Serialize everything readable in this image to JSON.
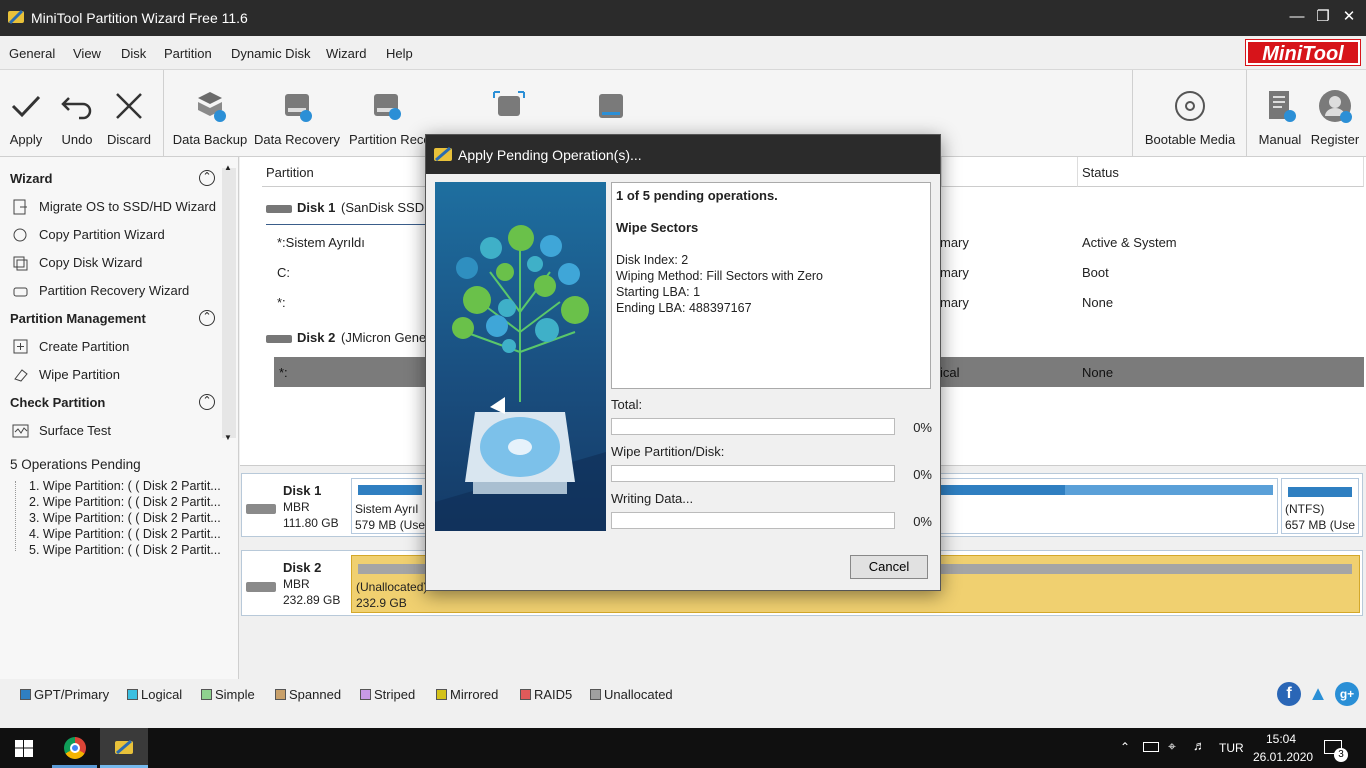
{
  "window": {
    "title": "MiniTool Partition Wizard Free 11.6"
  },
  "menu": [
    "General",
    "View",
    "Disk",
    "Partition",
    "Dynamic Disk",
    "Wizard",
    "Help"
  ],
  "logo": "MiniTool",
  "toolbar": {
    "apply": "Apply",
    "undo": "Undo",
    "discard": "Discard",
    "data_backup": "Data Backup",
    "data_recovery": "Data Recovery",
    "partition_recovery": "Partition Reco",
    "bootable_media": "Bootable Media",
    "manual": "Manual",
    "register": "Register"
  },
  "sidebar": {
    "wizard_title": "Wizard",
    "wizard_items": [
      "Migrate OS to SSD/HD Wizard",
      "Copy Partition Wizard",
      "Copy Disk Wizard",
      "Partition Recovery Wizard"
    ],
    "pm_title": "Partition Management",
    "pm_items": [
      "Create Partition",
      "Wipe Partition"
    ],
    "check_title": "Check Partition",
    "check_items": [
      "Surface Test"
    ],
    "pending_title": "5 Operations Pending",
    "pending_items": [
      "1. Wipe Partition: ( ( Disk 2 Partit...",
      "2. Wipe Partition: ( ( Disk 2 Partit...",
      "3. Wipe Partition: ( ( Disk 2 Partit...",
      "4. Wipe Partition: ( ( Disk 2 Partit...",
      "5. Wipe Partition: ( ( Disk 2 Partit..."
    ]
  },
  "table": {
    "col_partition": "Partition",
    "col_status": "Status",
    "disk1_label": "Disk 1",
    "disk1_desc": "(SanDisk SSD P",
    "disk2_label": "Disk 2",
    "disk2_desc": "(JMicron Gener",
    "rows": [
      {
        "name": "*:Sistem Ayrıldı",
        "type": "mary",
        "status": "Active & System"
      },
      {
        "name": "C:",
        "type": "mary",
        "status": "Boot"
      },
      {
        "name": "*:",
        "type": "mary",
        "status": "None"
      },
      {
        "name": "*:",
        "type": "ical",
        "status": "None"
      }
    ]
  },
  "diskmap": {
    "disk1": {
      "name": "Disk 1",
      "style": "MBR",
      "size": "111.80 GB",
      "p1_label": "Sistem Ayrıl",
      "p1_size": "579 MB (Use",
      "p3_label": "(NTFS)",
      "p3_size": "657 MB (Use"
    },
    "disk2": {
      "name": "Disk 2",
      "style": "MBR",
      "size": "232.89 GB",
      "p1_label": "(Unallocated)",
      "p1_size": "232.9 GB"
    }
  },
  "legend": [
    {
      "label": "GPT/Primary",
      "color": "#2f7fc1"
    },
    {
      "label": "Logical",
      "color": "#3bbfe0"
    },
    {
      "label": "Simple",
      "color": "#8fd18f"
    },
    {
      "label": "Spanned",
      "color": "#c8a06a"
    },
    {
      "label": "Striped",
      "color": "#c79ae6"
    },
    {
      "label": "Mirrored",
      "color": "#d4c21a"
    },
    {
      "label": "RAID5",
      "color": "#e05a5a"
    },
    {
      "label": "Unallocated",
      "color": "#a0a0a0"
    }
  ],
  "dialog": {
    "title": "Apply Pending Operation(s)...",
    "headline": "1 of 5 pending operations.",
    "op_name": "Wipe Sectors",
    "details": [
      "Disk Index: 2",
      "Wiping Method: Fill Sectors with Zero",
      "Starting LBA: 1",
      "Ending LBA: 488397167"
    ],
    "total_label": "Total:",
    "total_pct": "0%",
    "wipe_label": "Wipe Partition/Disk:",
    "wipe_pct": "0%",
    "write_label": "Writing Data...",
    "write_pct": "0%",
    "cancel": "Cancel"
  },
  "taskbar": {
    "lang": "TUR",
    "time": "15:04",
    "date": "26.01.2020",
    "notif_count": "3"
  }
}
